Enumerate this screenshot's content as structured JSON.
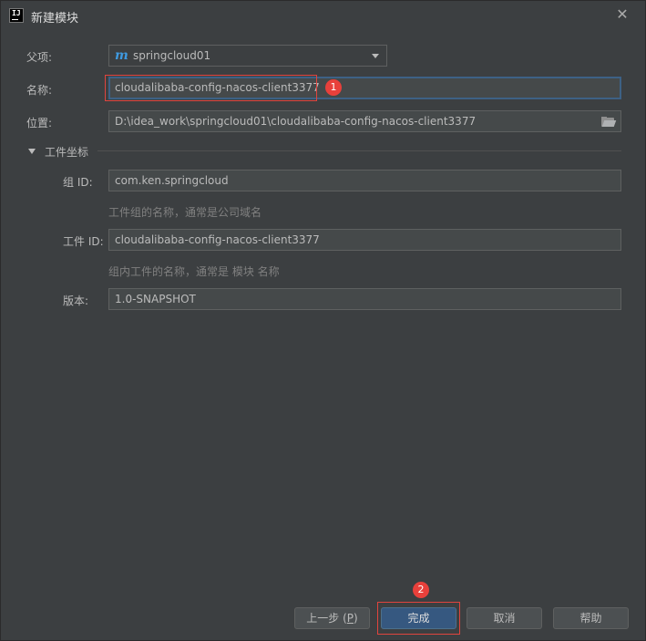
{
  "window": {
    "title": "新建模块"
  },
  "form": {
    "parent_label": "父项:",
    "parent_value": "springcloud01",
    "name_label": "名称:",
    "name_value": "cloudalibaba-config-nacos-client3377",
    "location_label": "位置:",
    "location_value": "D:\\idea_work\\springcloud01\\cloudalibaba-config-nacos-client3377",
    "artifact_section_label": "工件坐标",
    "group_id_label": "组 ID:",
    "group_id_value": "com.ken.springcloud",
    "group_id_hint": "工件组的名称，通常是公司域名",
    "artifact_id_label": "工件 ID:",
    "artifact_id_value": "cloudalibaba-config-nacos-client3377",
    "artifact_id_hint": "组内工件的名称，通常是 模块 名称",
    "version_label": "版本:",
    "version_value": "1.0-SNAPSHOT"
  },
  "annotations": {
    "badge_1": "1",
    "badge_2": "2"
  },
  "buttons": {
    "previous_label": "上一步 (",
    "previous_mnemonic": "P",
    "previous_suffix": ")",
    "finish_label": "完成",
    "cancel_label": "取消",
    "help_label": "帮助"
  },
  "icons": {
    "app": "intellij-idea-icon",
    "maven": "maven-m-icon",
    "close": "close-icon",
    "dropdown": "chevron-down-icon",
    "folder": "folder-browse-icon",
    "section_toggle": "triangle-down-icon"
  },
  "colors": {
    "background": "#3c3f41",
    "field_background": "#45494a",
    "focus_border": "#3d6185",
    "default_button": "#365880",
    "annotation_red": "#e8403b"
  }
}
